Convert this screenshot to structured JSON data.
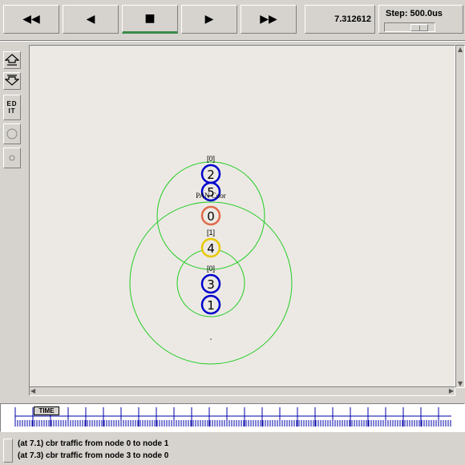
{
  "toolbar": {
    "buttons": [
      {
        "name": "rewind",
        "glyph": "◀◀"
      },
      {
        "name": "back",
        "glyph": "◀"
      },
      {
        "name": "stop",
        "glyph": "■"
      },
      {
        "name": "play",
        "glyph": "▶"
      },
      {
        "name": "fast-forward",
        "glyph": "▶▶"
      }
    ],
    "time": "7.312612",
    "step_label": "Step: 500.0us"
  },
  "left_tools": {
    "edit_label_1": "ED",
    "edit_label_2": "IT"
  },
  "network": {
    "nodes": [
      {
        "id": "2",
        "color": "#0000cc",
        "top_label": "[0]"
      },
      {
        "id": "5",
        "color": "#0000cc",
        "top_label": ""
      },
      {
        "id": "0",
        "color": "#e06a4a",
        "top_label": "",
        "caption": "PAN Coor"
      },
      {
        "id": "4",
        "color": "#e8c800",
        "top_label": "[1]"
      },
      {
        "id": "3",
        "color": "#0000cc",
        "top_label": "[0]"
      },
      {
        "id": "1",
        "color": "#0000cc",
        "top_label": ""
      }
    ],
    "range_color": "#22cc22"
  },
  "timeline": {
    "marker_label": "TIME"
  },
  "log": [
    "(at 7.1) cbr traffic from node 0 to node 1",
    "(at 7.3) cbr traffic from node 3 to node 0"
  ]
}
